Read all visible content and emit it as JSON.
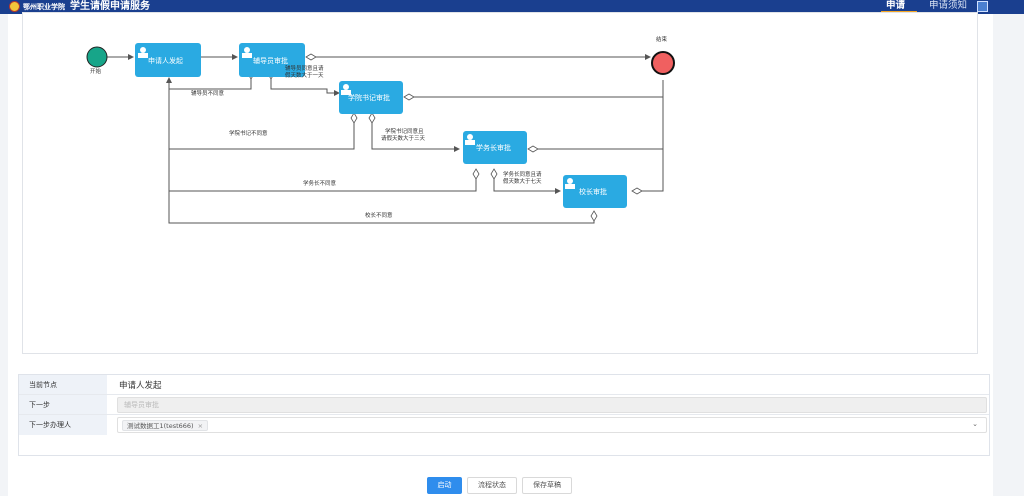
{
  "header": {
    "logo_text": "鄂州职业学院",
    "app_title": "学生请假申请服务",
    "tabs": [
      {
        "label": "申请",
        "active": true
      },
      {
        "label": "申请须知",
        "active": false
      }
    ],
    "colors": {
      "bar": "#1a3f8f",
      "active_underline": "#f5a623"
    }
  },
  "flow": {
    "start_label": "开始",
    "end_label": "结束",
    "nodes": [
      {
        "label": "申请人发起"
      },
      {
        "label": "辅导员审批"
      },
      {
        "label": "学院书记审批"
      },
      {
        "label": "学务长审批"
      },
      {
        "label": "校长审批"
      }
    ],
    "edge_labels": {
      "counselor_reject": "辅导员不同意",
      "counselor_approve_line1": "辅导员同意且请",
      "counselor_approve_line2": "假天数大于一天",
      "secretary_reject": "学院书记不同意",
      "secretary_approve_line1": "学院书记同意且",
      "secretary_approve_line2": "请假天数大于三天",
      "dean_reject": "学务长不同意",
      "dean_approve_line1": "学务长同意且请",
      "dean_approve_line2": "假天数大于七天",
      "president_reject": "校长不同意"
    },
    "colors": {
      "node": "#2aaae2",
      "start": "#17a589",
      "end": "#f06060",
      "line": "#555555"
    }
  },
  "form": {
    "current_node_label": "当前节点",
    "current_node_value": "申请人发起",
    "next_step_label": "下一步",
    "next_step_value": "辅导员审批",
    "next_handler_label": "下一步办理人",
    "handler_tag": "测试数据工1(test666)",
    "tag_close": "×",
    "dropdown_icon": "chevron-down-icon"
  },
  "actions": {
    "start": "启动",
    "flow_status": "流程状态",
    "save_draft": "保存草稿"
  }
}
